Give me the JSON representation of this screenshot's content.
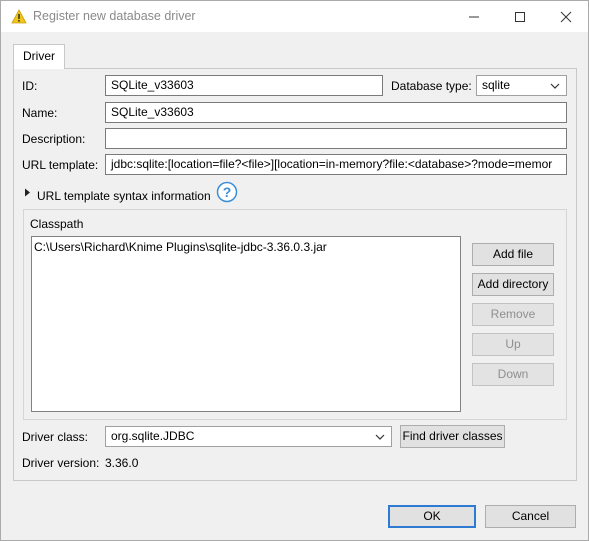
{
  "window": {
    "title": "Register new database driver"
  },
  "tabs": [
    {
      "label": "Driver"
    }
  ],
  "form": {
    "id_label": "ID:",
    "id_value": "SQLite_v33603",
    "database_type_label": "Database type:",
    "database_type_value": "sqlite",
    "name_label": "Name:",
    "name_value": "SQLite_v33603",
    "description_label": "Description:",
    "description_value": "",
    "url_template_label": "URL template:",
    "url_template_value": "jdbc:sqlite:[location=file?<file>][location=in-memory?file:<database>?mode=memor",
    "url_syntax_info_label": "URL template syntax information"
  },
  "classpath": {
    "group_label": "Classpath",
    "items": [
      "C:\\Users\\Richard\\Knime Plugins\\sqlite-jdbc-3.36.0.3.jar"
    ],
    "buttons": {
      "add_file": "Add file",
      "add_directory": "Add directory",
      "remove": "Remove",
      "up": "Up",
      "down": "Down"
    }
  },
  "driver": {
    "class_label": "Driver class:",
    "class_value": "org.sqlite.JDBC",
    "find_button": "Find driver classes",
    "version_label": "Driver version:",
    "version_value": "3.36.0"
  },
  "footer": {
    "ok_label": "OK",
    "cancel_label": "Cancel"
  },
  "colors": {
    "accent": "#2f7bd4",
    "help_icon": "#3b8ed8",
    "warning_icon": "#f0c419"
  },
  "icons": {
    "window": "warning-triangle-icon",
    "help": "question-circle-icon",
    "expander": "triangle-right-icon",
    "dropdown": "chevron-down-icon"
  }
}
